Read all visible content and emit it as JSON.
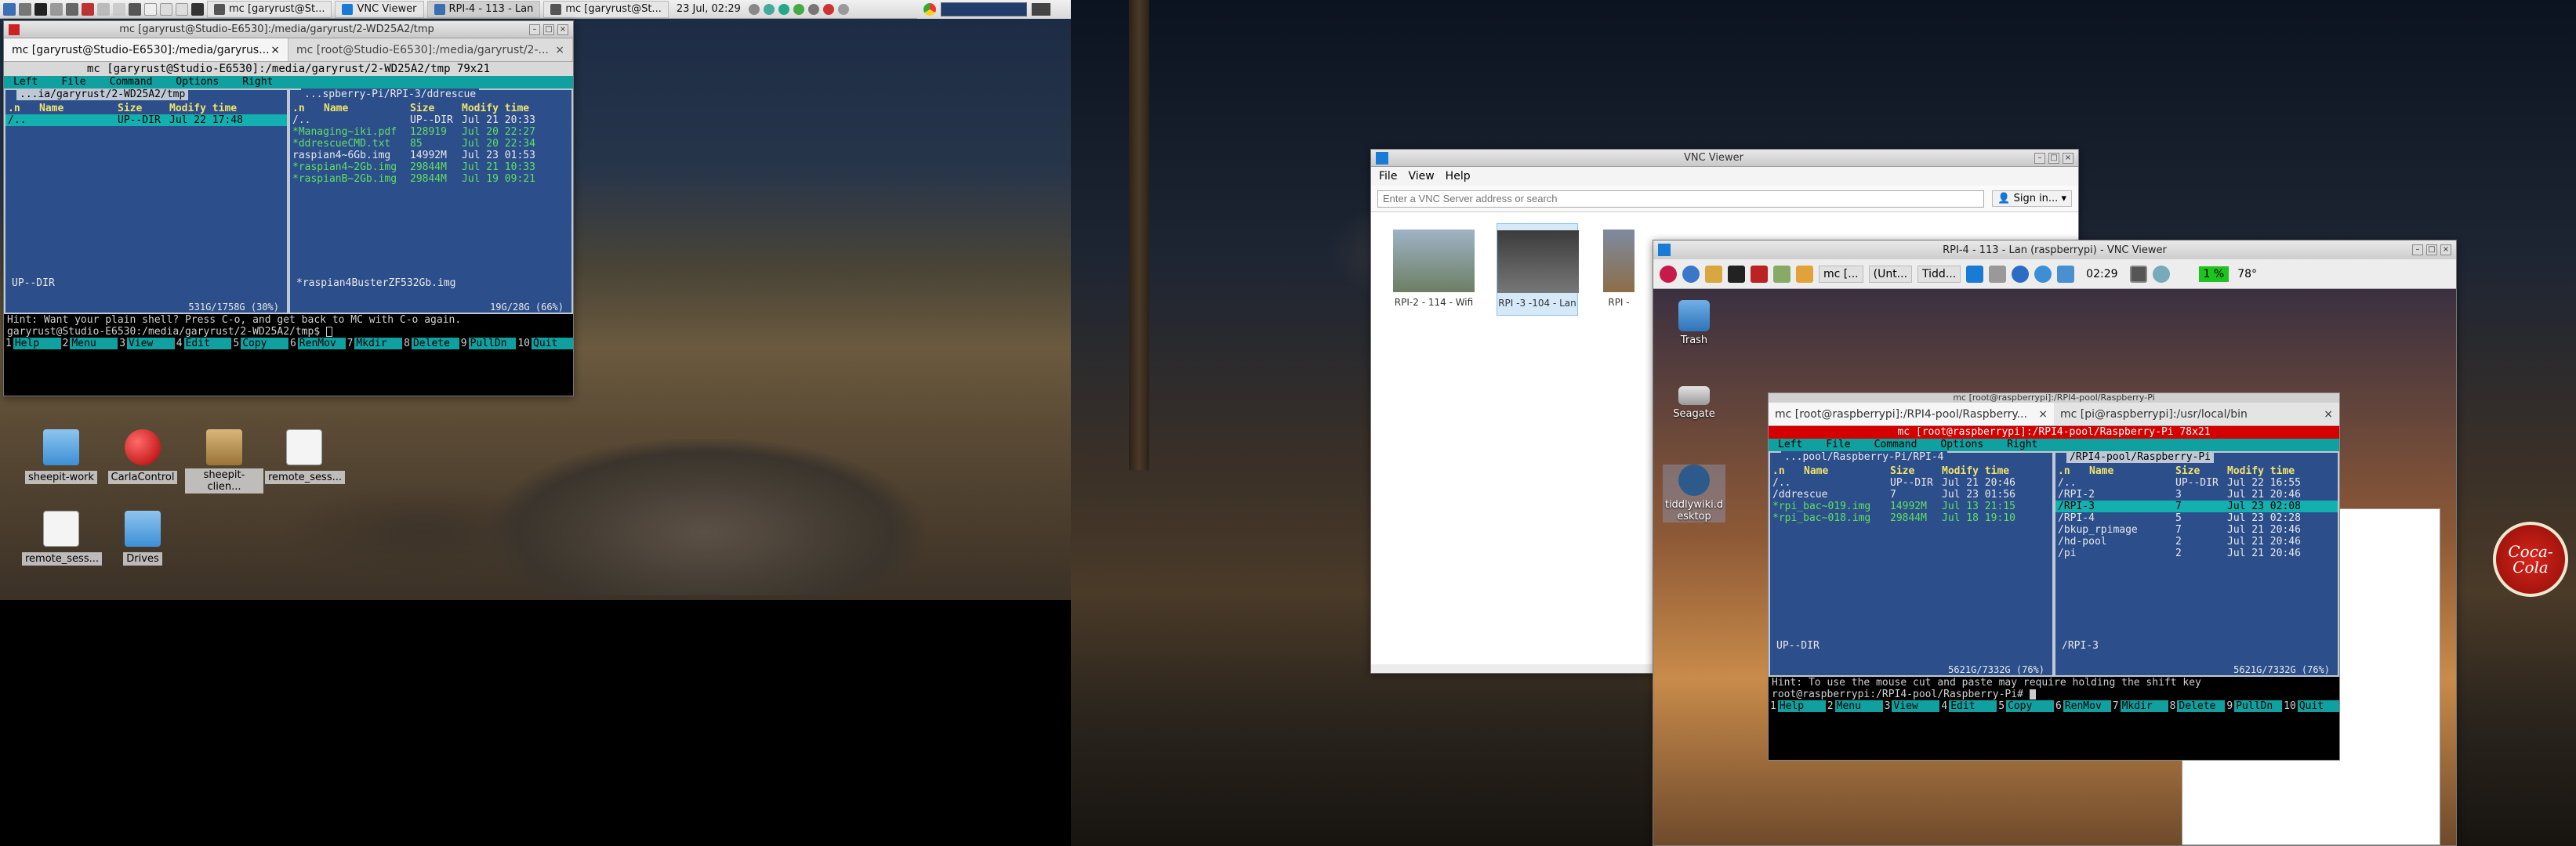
{
  "left_panel": {
    "tasks": [
      {
        "label": "mc [garyrust@St...",
        "color": "#555555"
      },
      {
        "label": "VNC Viewer",
        "color": "#1a7bd6"
      },
      {
        "label": "RPI-4 - 113 - Lan",
        "color": "#3a6fb0"
      },
      {
        "label": "mc [garyrust@St...",
        "color": "#555555"
      }
    ],
    "clock": "23 Jul, 02:29"
  },
  "desktop_icons": [
    {
      "label": "sheepit-work",
      "icon": "folder-icon"
    },
    {
      "label": "CarlaControl",
      "icon": "red-sphere-icon"
    },
    {
      "label": "sheepit-clien...",
      "icon": "archive-icon"
    },
    {
      "label": "remote_sess...",
      "icon": "document-icon"
    },
    {
      "label": "remote_sess...",
      "icon": "document-icon"
    },
    {
      "label": "Drives",
      "icon": "folder-icon"
    }
  ],
  "mc_left": {
    "window_title": "mc [garyrust@Studio-E6530]:/media/garyrust/2-WD25A2/tmp",
    "tabs": [
      "mc [garyrust@Studio-E6530]:/media/garyrus...",
      "mc [root@Studio-E6530]:/media/garyrust/2-..."
    ],
    "title": "mc [garyrust@Studio-E6530]:/media/garyrust/2-WD25A2/tmp 79x21",
    "menu": [
      "Left",
      "File",
      "Command",
      "Options",
      "Right"
    ],
    "left_panel": {
      "path": "...ia/garyrust/2-WD25A2/tmp",
      "headers": [
        ".n",
        "Name",
        "Size",
        "Modify time"
      ],
      "rows": [
        {
          "name": "/..",
          "size": "UP--DIR",
          "time": "Jul 22 17:48",
          "cursor": true
        }
      ],
      "footer": "UP--DIR",
      "usage": "531G/1758G (30%)"
    },
    "right_panel": {
      "path": "...spberry-Pi/RPI-3/ddrescue",
      "headers": [
        ".n",
        "Name",
        "Size",
        "Modify time"
      ],
      "rows": [
        {
          "name": "/..",
          "size": "UP--DIR",
          "time": "Jul 21 20:33"
        },
        {
          "name": "*Managing~iki.pdf",
          "size": "128919",
          "time": "Jul 20 22:27",
          "hl": true
        },
        {
          "name": "*ddrescueCMD.txt",
          "size": "85",
          "time": "Jul 20 22:34",
          "hl": true
        },
        {
          "name": " raspian4~6Gb.img",
          "size": "14992M",
          "time": "Jul 23 01:53"
        },
        {
          "name": "*raspian4~2Gb.img",
          "size": "29844M",
          "time": "Jul 21 10:33",
          "hl": true
        },
        {
          "name": "*raspianB~2Gb.img",
          "size": "29844M",
          "time": "Jul 19 09:21",
          "hl": true
        }
      ],
      "footer": "*raspian4BusterZF532Gb.img",
      "usage": "19G/28G (66%)"
    },
    "hint": "Hint: Want your plain shell? Press C-o, and get back to MC with C-o again.",
    "prompt": "garyrust@Studio-E6530:/media/garyrust/2-WD25A2/tmp$",
    "fkeys": [
      "Help",
      "Menu",
      "View",
      "Edit",
      "Copy",
      "RenMov",
      "Mkdir",
      "Delete",
      "PullDn",
      "Quit"
    ]
  },
  "vnc_viewer": {
    "title": "VNC Viewer",
    "menu": [
      "File",
      "View",
      "Help"
    ],
    "search_placeholder": "Enter a VNC Server address or search",
    "sign_in": "Sign in...",
    "connections": [
      {
        "label": "RPI-2 - 114 - Wifi",
        "selected": false
      },
      {
        "label": "RPI -3 -104 - Lan",
        "selected": true
      },
      {
        "label": "RPI -",
        "selected": false
      }
    ]
  },
  "rpi_session": {
    "title": "RPI-4 - 113 - Lan (raspberrypi) - VNC Viewer",
    "taskbar_tasks": [
      "mc [...",
      "(Unt...",
      "Tidd..."
    ],
    "clock": "02:29",
    "cpu": "1 %",
    "temp": "78°",
    "desktop_icons": [
      "Trash",
      "Seagate",
      "tiddlywiki.desktop"
    ],
    "inner_window_title": "mc [root@raspberrypi]:/RPI4-pool/Raspberry-Pi",
    "tabs": [
      "mc [root@raspberrypi]:/RPI4-pool/Raspberry...",
      "mc [pi@raspberrypi]:/usr/local/bin"
    ],
    "mc_title": "mc [root@raspberrypi]:/RPI4-pool/Raspberry-Pi 78x21",
    "menu": [
      "Left",
      "File",
      "Command",
      "Options",
      "Right"
    ],
    "left_panel": {
      "path": "...pool/Raspberry-Pi/RPI-4",
      "headers": [
        ".n",
        "Name",
        "Size",
        "Modify time"
      ],
      "rows": [
        {
          "name": "/..",
          "size": "UP--DIR",
          "time": "Jul 21 20:46"
        },
        {
          "name": "/ddrescue",
          "size": "7",
          "time": "Jul 23 01:56"
        },
        {
          "name": "*rpi_bac~019.img",
          "size": "14992M",
          "time": "Jul 13 21:15",
          "hl": true
        },
        {
          "name": "*rpi_bac~018.img",
          "size": "29844M",
          "time": "Jul 18 19:10",
          "hl": true
        }
      ],
      "footer": "UP--DIR",
      "usage": "5621G/7332G (76%)"
    },
    "right_panel": {
      "path": "/RPI4-pool/Raspberry-Pi",
      "headers": [
        ".n",
        "Name",
        "Size",
        "Modify time"
      ],
      "rows": [
        {
          "name": "/..",
          "size": "UP--DIR",
          "time": "Jul 22 16:55"
        },
        {
          "name": "/RPI-2",
          "size": "3",
          "time": "Jul 21 20:46"
        },
        {
          "name": "/RPI-3",
          "size": "7",
          "time": "Jul 23 02:08",
          "cursor": true
        },
        {
          "name": "/RPI-4",
          "size": "5",
          "time": "Jul 23 02:28"
        },
        {
          "name": "/bkup_rpimage",
          "size": "7",
          "time": "Jul 21 20:46"
        },
        {
          "name": "/hd-pool",
          "size": "2",
          "time": "Jul 21 20:46"
        },
        {
          "name": "/pi",
          "size": "2",
          "time": "Jul 21 20:46"
        }
      ],
      "footer": "/RPI-3",
      "usage": "5621G/7332G (76%)"
    },
    "hint": "Hint: To use the mouse cut and paste may require holding the shift key",
    "prompt": "root@raspberrypi:/RPI4-pool/Raspberry-Pi#",
    "fkeys": [
      "Help",
      "Menu",
      "View",
      "Edit",
      "Copy",
      "RenMov",
      "Mkdir",
      "Delete",
      "PullDn",
      "Quit"
    ]
  },
  "sign_text": "Coca-Cola"
}
